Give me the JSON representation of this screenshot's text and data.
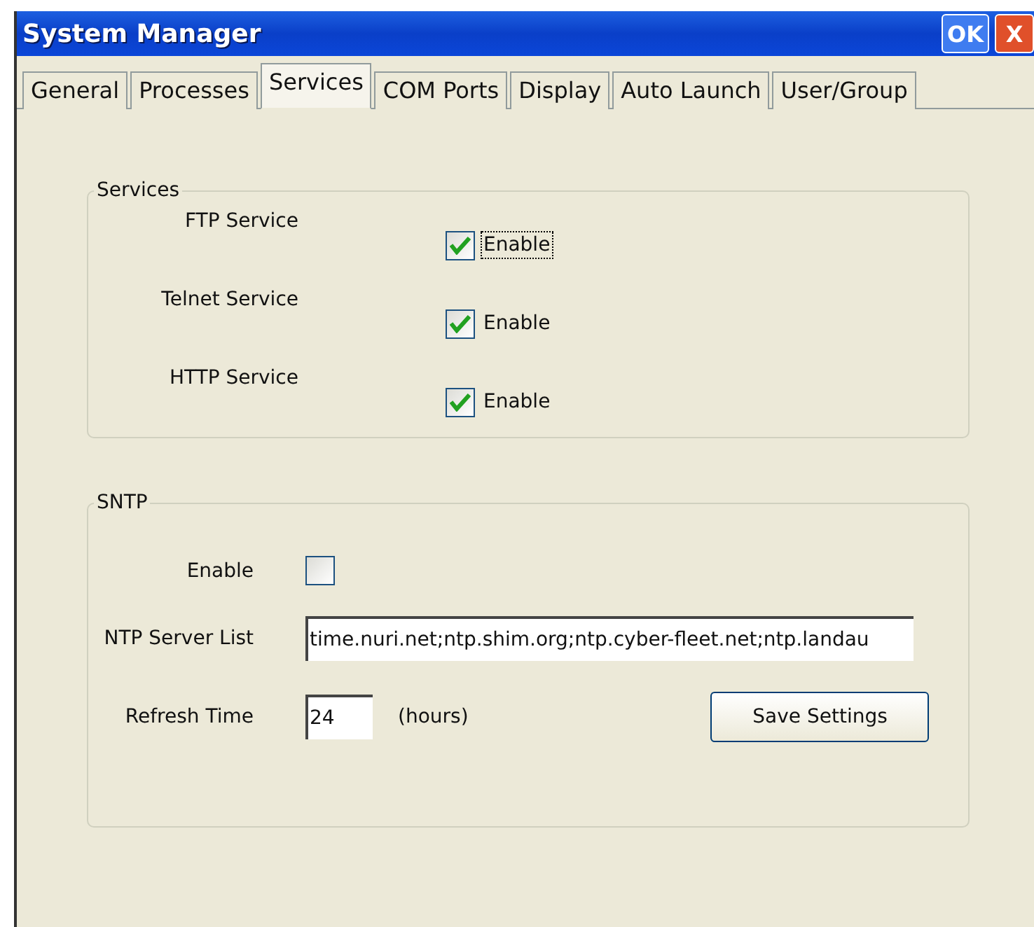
{
  "window": {
    "title": "System Manager",
    "buttons": [
      {
        "kind": "ok",
        "label": "OK"
      },
      {
        "kind": "close",
        "label": "X"
      }
    ]
  },
  "tabs": [
    {
      "label": "General",
      "selected": false
    },
    {
      "label": "Processes",
      "selected": false
    },
    {
      "label": "Services",
      "selected": true
    },
    {
      "label": "COM Ports",
      "selected": false
    },
    {
      "label": "Display",
      "selected": false
    },
    {
      "label": "Auto Launch",
      "selected": false
    },
    {
      "label": "User/Group",
      "selected": false
    }
  ],
  "services": {
    "title": "Services",
    "rows": [
      {
        "label": "FTP Service",
        "checkbox": "Enable",
        "checked": true,
        "focused": true
      },
      {
        "label": "Telnet Service",
        "checkbox": "Enable",
        "checked": true,
        "focused": false
      },
      {
        "label": "HTTP Service",
        "checkbox": "Enable",
        "checked": true,
        "focused": false
      }
    ]
  },
  "sntp": {
    "title": "SNTP",
    "enable": {
      "label": "Enable",
      "checked": false
    },
    "server_list": {
      "label": "NTP Server List",
      "value": "time.nuri.net;ntp.shim.org;ntp.cyber-fleet.net;ntp.landau"
    },
    "refresh": {
      "label": "Refresh Time",
      "value": "24",
      "unit": "(hours)"
    },
    "save_button": "Save Settings"
  }
}
